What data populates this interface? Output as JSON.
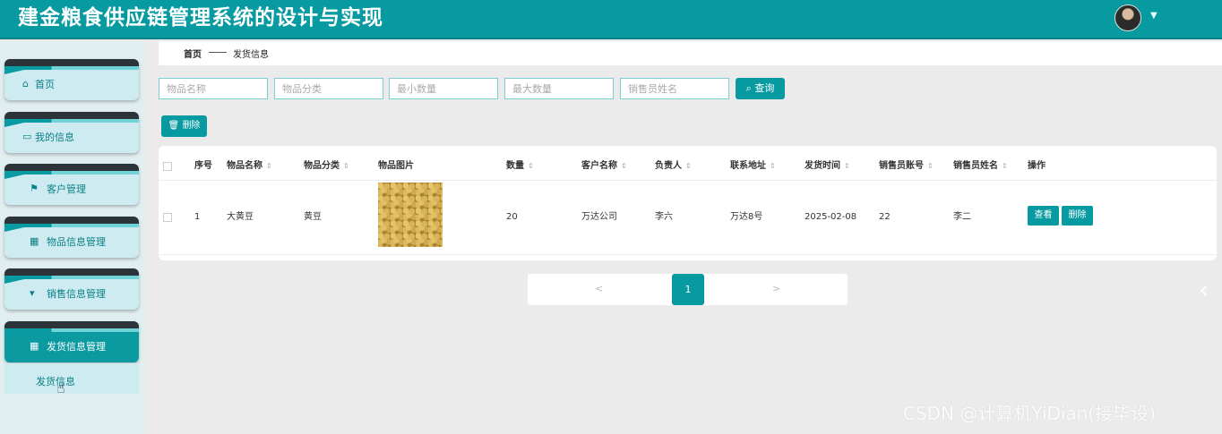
{
  "app": {
    "title": "建金粮食供应链管理系统的设计与实现"
  },
  "sidebar": {
    "items": [
      {
        "label": "首页",
        "icon": "home-icon"
      },
      {
        "label": "我的信息",
        "icon": "card-icon"
      },
      {
        "label": "客户管理",
        "icon": "flag-icon"
      },
      {
        "label": "物品信息管理",
        "icon": "grid-icon"
      },
      {
        "label": "销售信息管理",
        "icon": "cup-icon"
      },
      {
        "label": "发货信息管理",
        "icon": "grid-icon"
      }
    ],
    "submenu": {
      "label": "发货信息"
    }
  },
  "breadcrumb": {
    "home": "首页",
    "current": "发货信息"
  },
  "search": {
    "placeholders": [
      "物品名称",
      "物品分类",
      "最小数量",
      "最大数量",
      "销售员姓名"
    ],
    "query_label": "查询"
  },
  "toolbar": {
    "delete_label": "删除"
  },
  "table": {
    "headers": [
      "序号",
      "物品名称",
      "物品分类",
      "物品图片",
      "数量",
      "客户名称",
      "负责人",
      "联系地址",
      "发货时间",
      "销售员账号",
      "销售员姓名",
      "操作"
    ],
    "rows": [
      {
        "index": "1",
        "name": "大黄豆",
        "category": "黄豆",
        "quantity": "20",
        "customer": "万达公司",
        "manager": "李六",
        "address": "万达8号",
        "ship_time": "2025-02-08",
        "seller_account": "22",
        "seller_name": "李二",
        "view_label": "查看",
        "delete_label": "删除"
      }
    ]
  },
  "pagination": {
    "prev": "<",
    "current": "1",
    "next": ">"
  },
  "watermark": "CSDN @计算机YiDian(接毕设)",
  "colors": {
    "accent": "#079aa0",
    "sidebar_bg": "#e0eef0"
  }
}
